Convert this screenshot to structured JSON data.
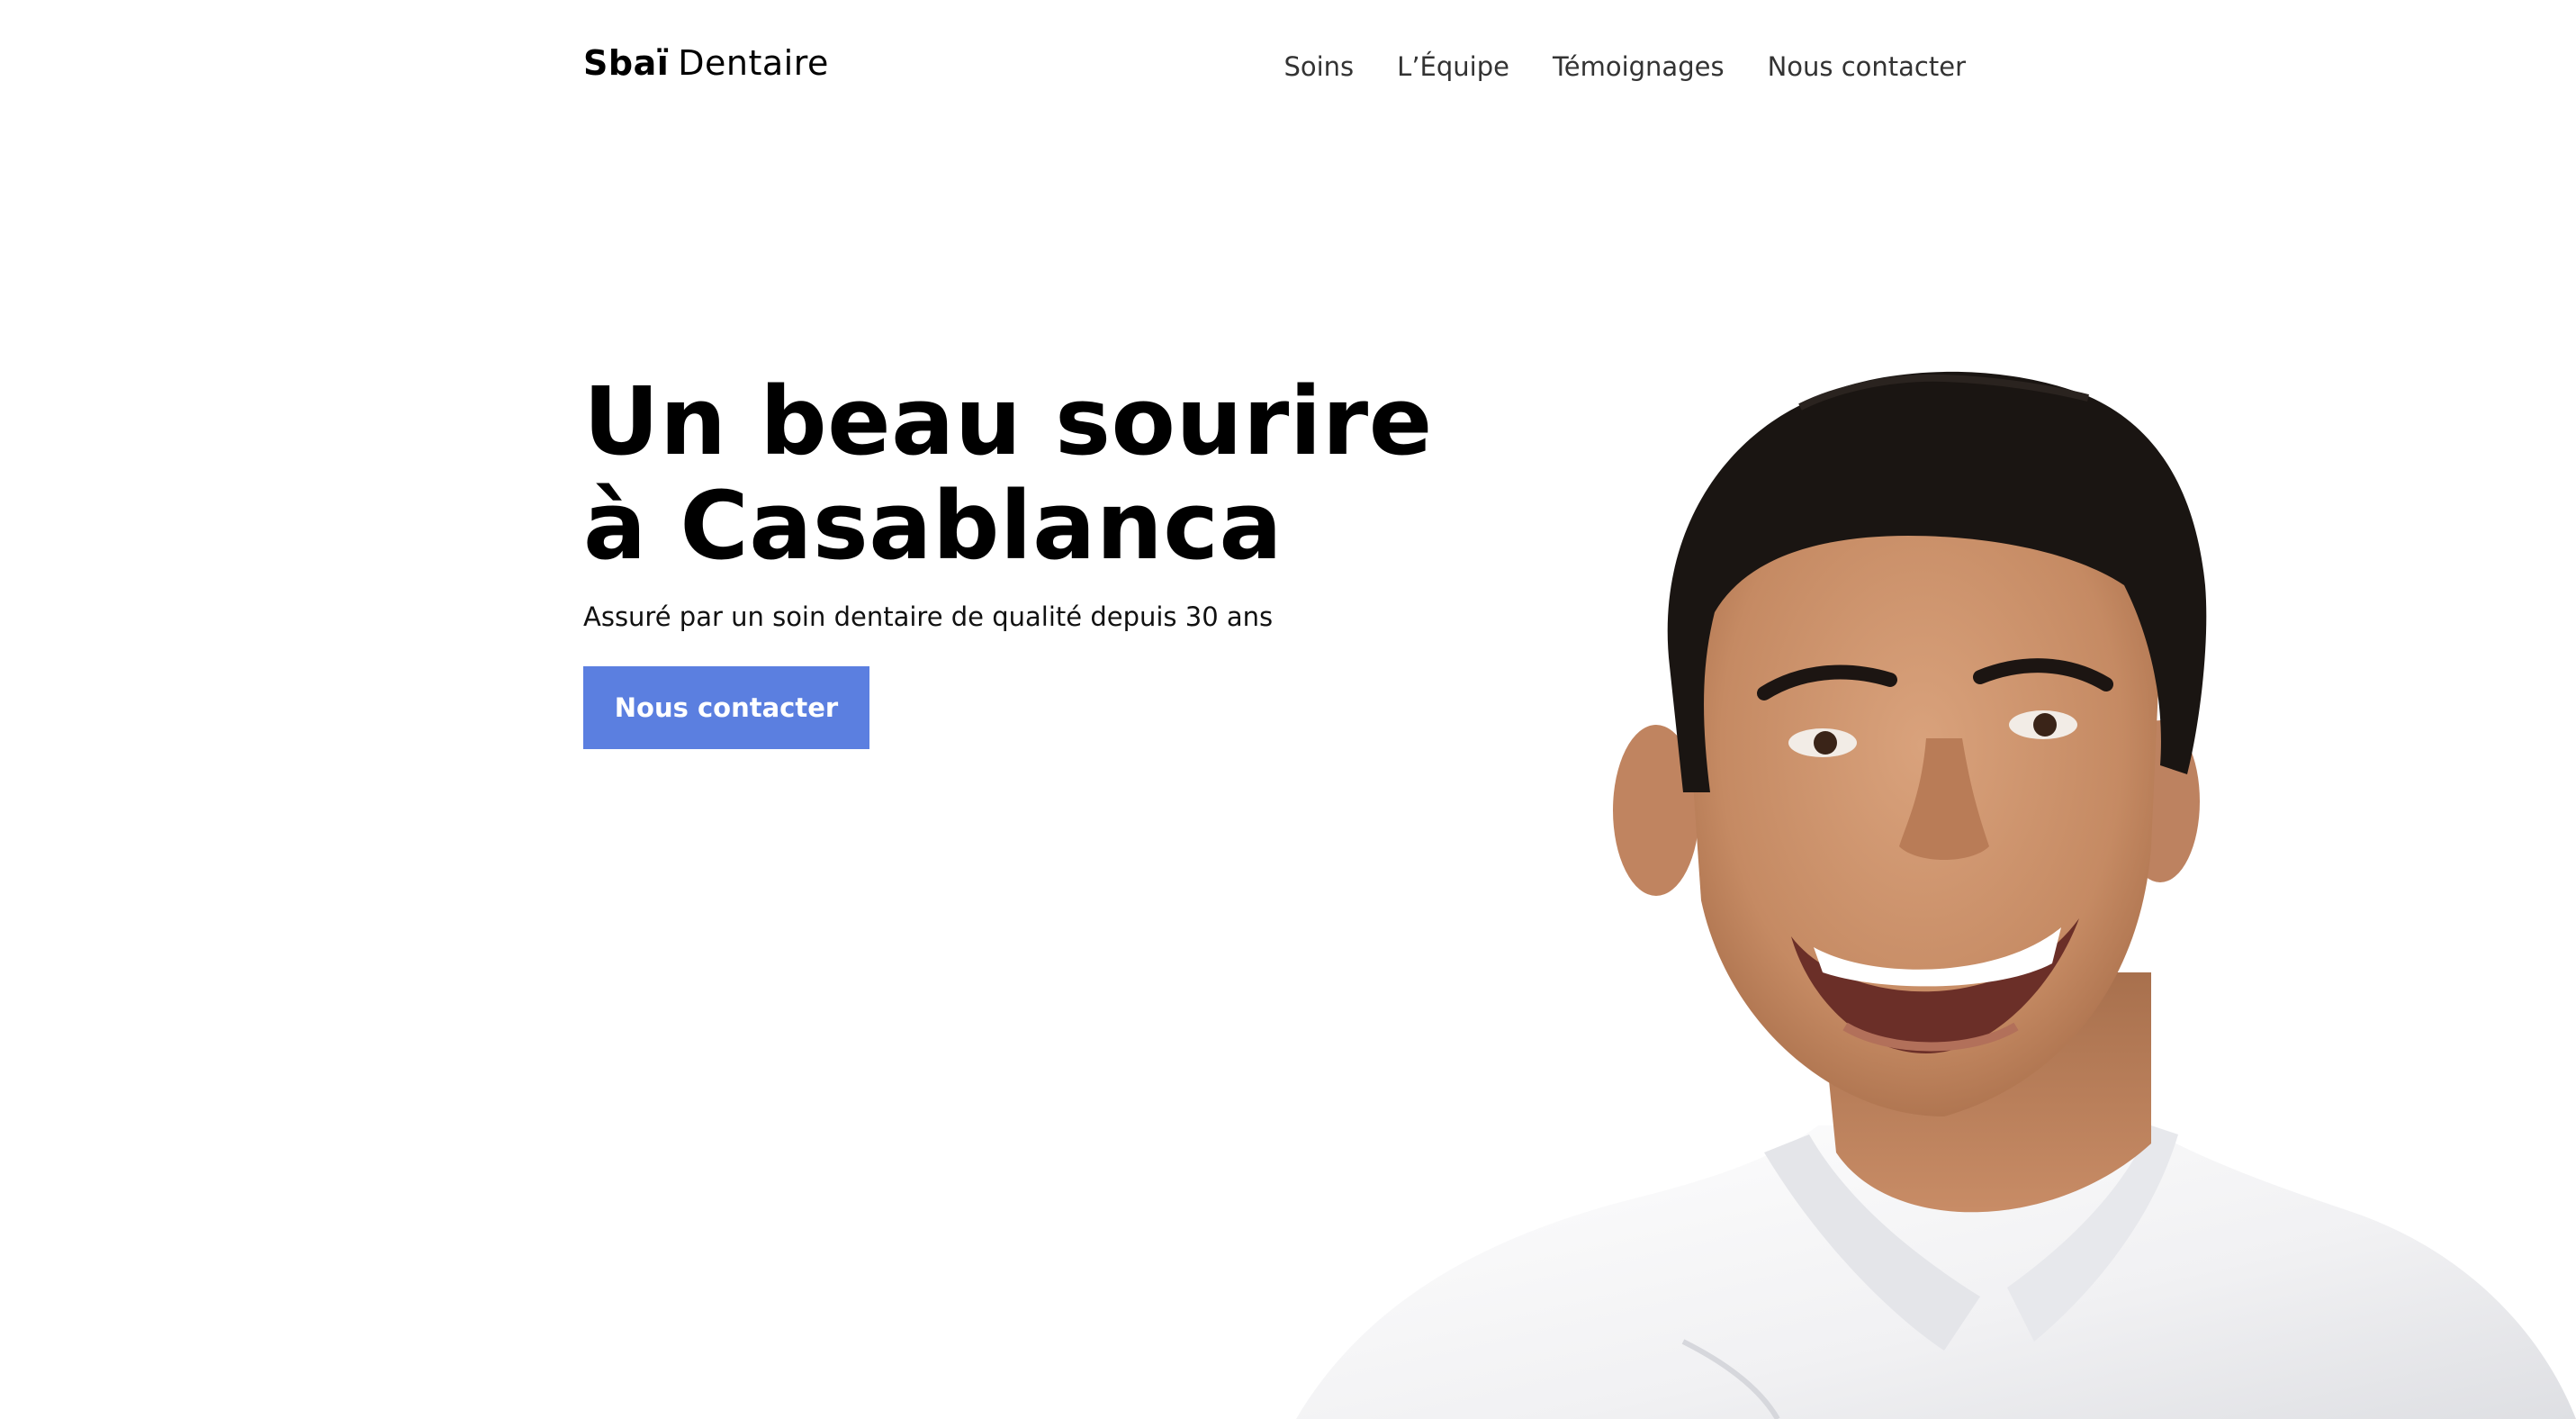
{
  "header": {
    "logo_bold": "Sbaï",
    "logo_light": "Dentaire",
    "nav": [
      {
        "label": "Soins"
      },
      {
        "label": "L’Équipe"
      },
      {
        "label": "Témoignages"
      },
      {
        "label": "Nous contacter"
      }
    ]
  },
  "hero": {
    "title_line1": "Un beau sourire",
    "title_line2": "à Casablanca",
    "subtitle": "Assuré par un soin dentaire de qualité depuis 30 ans",
    "cta_label": "Nous contacter"
  },
  "colors": {
    "accent": "#5b7fe0",
    "text": "#000000",
    "nav_text": "#333333"
  }
}
